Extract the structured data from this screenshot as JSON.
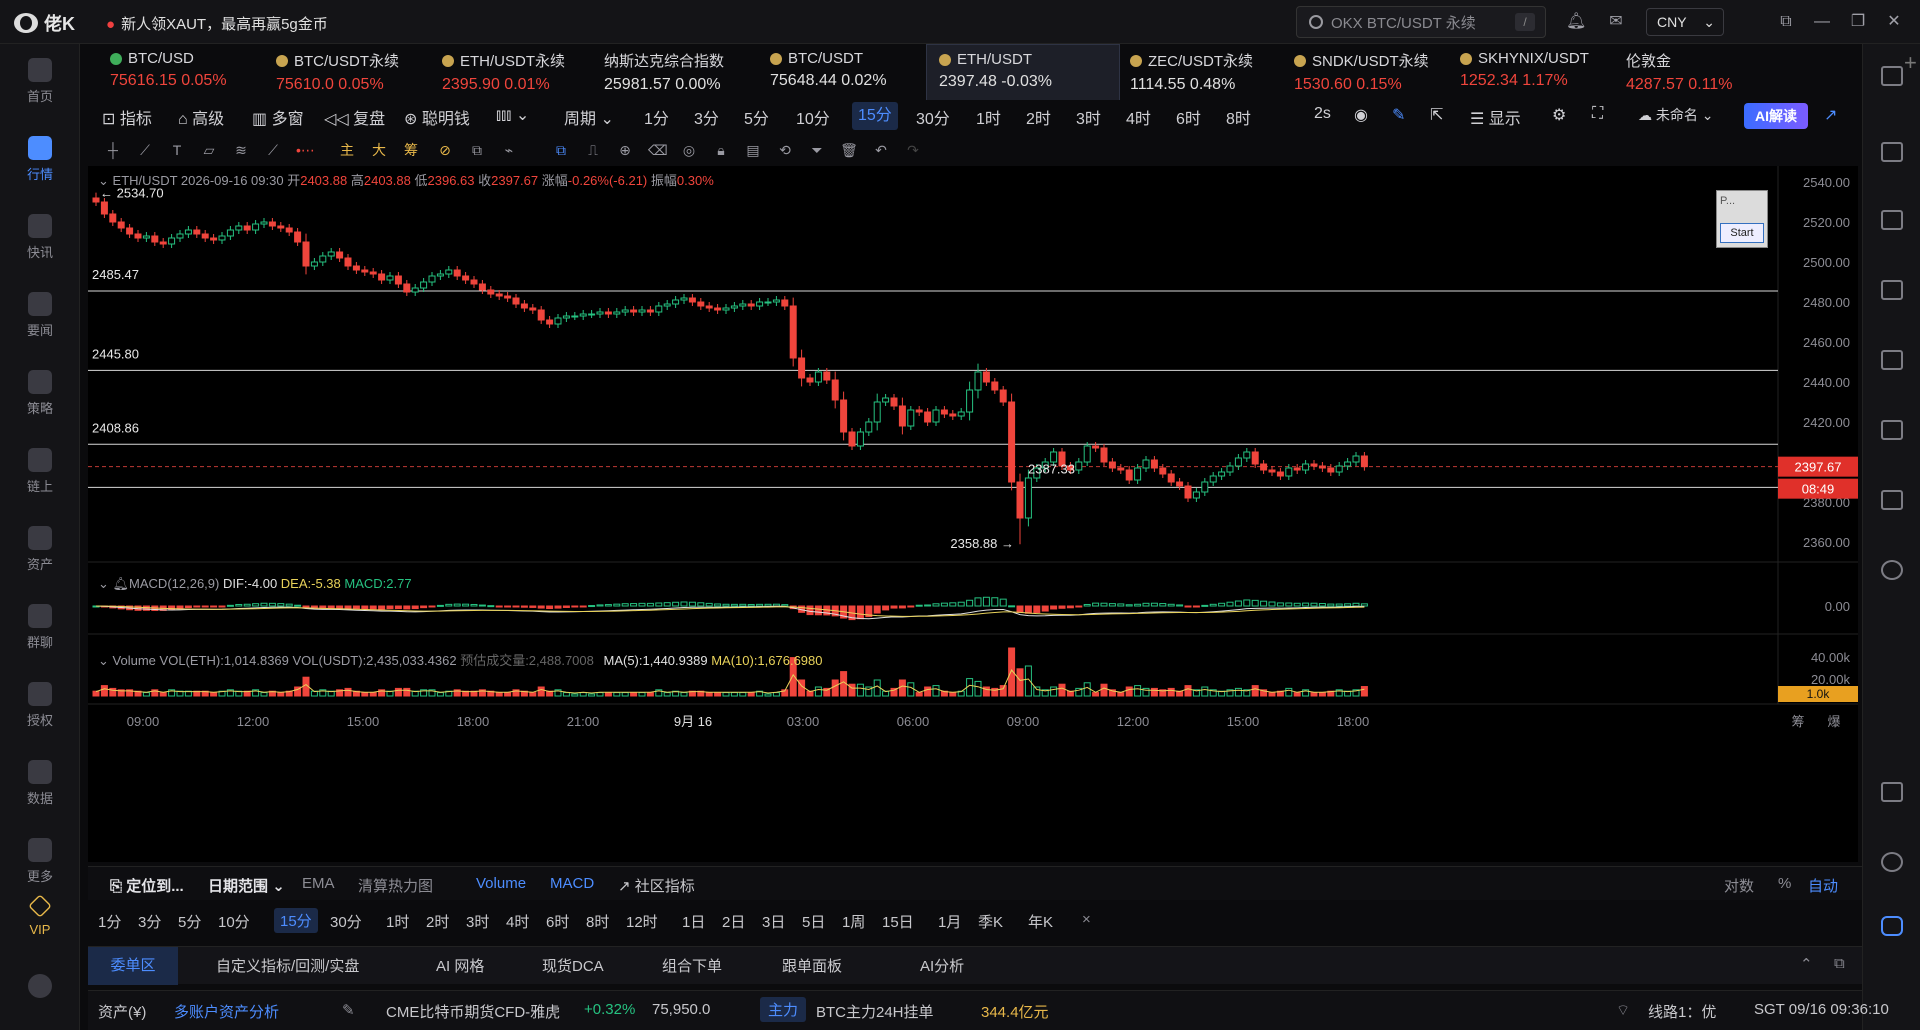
{
  "titlebar": {
    "app_name": "佬K",
    "promo": "新人领XAUT，最高再赢5g金币",
    "search_placeholder": "OKX BTC/USDT 永续",
    "search_shortcut": "/",
    "currency": "CNY"
  },
  "sidebar": {
    "items": [
      {
        "label": "首页",
        "icon": "home-icon"
      },
      {
        "label": "行情",
        "icon": "market-icon"
      },
      {
        "label": "快讯",
        "icon": "flash-news-icon"
      },
      {
        "label": "要闻",
        "icon": "headline-icon"
      },
      {
        "label": "策略",
        "icon": "strategy-icon"
      },
      {
        "label": "链上",
        "icon": "onchain-icon"
      },
      {
        "label": "资产",
        "icon": "wallet-icon"
      },
      {
        "label": "群聊",
        "icon": "chat-icon"
      },
      {
        "label": "授权",
        "icon": "auth-icon"
      },
      {
        "label": "数据",
        "icon": "data-icon"
      },
      {
        "label": "更多",
        "icon": "more-icon"
      },
      {
        "label": "VIP",
        "icon": "vip-icon"
      }
    ]
  },
  "tickers": [
    {
      "name": "BTC/USD",
      "price": "75616.15",
      "change": "0.05%",
      "tone": "red"
    },
    {
      "name": "BTC/USDT永续",
      "price": "75610.0",
      "change": "0.05%",
      "tone": "red"
    },
    {
      "name": "ETH/USDT永续",
      "price": "2395.90",
      "change": "0.01%",
      "tone": "red"
    },
    {
      "name": "纳斯达克综合指数",
      "price": "25981.57",
      "change": "0.00%",
      "tone": "neutral"
    },
    {
      "name": "BTC/USDT",
      "price": "75648.44",
      "change": "0.02%",
      "tone": "neutral"
    },
    {
      "name": "ETH/USDT",
      "price": "2397.48",
      "change": "-0.03%",
      "tone": "neutral"
    },
    {
      "name": "ZEC/USDT永续",
      "price": "1114.55",
      "change": "0.48%",
      "tone": "neutral"
    },
    {
      "name": "SNDK/USDT永续",
      "price": "1530.60",
      "change": "0.15%",
      "tone": "red"
    },
    {
      "name": "SKHYNIX/USDT",
      "price": "1252.34",
      "change": "1.17%",
      "tone": "red"
    },
    {
      "name": "伦敦金",
      "price": "4287.57",
      "change": "0.11%",
      "tone": "red"
    }
  ],
  "toolbar1": {
    "indicators": "指标",
    "advanced": "高级",
    "multi_window": "多窗",
    "replay": "复盘",
    "smart_money": "聪明钱",
    "period": "周期",
    "periods": [
      "1分",
      "3分",
      "5分",
      "10分",
      "15分",
      "30分",
      "1时",
      "2时",
      "3时",
      "4时",
      "6时",
      "8时"
    ],
    "refresh": "2s",
    "display": "显示",
    "layout_name": "未命名",
    "ai_button": "AI解读"
  },
  "chart": {
    "legend_main": {
      "symbol": "ETH/USDT",
      "datetime": "2026-09-16 09:30",
      "open_label": "开",
      "open": "2403.88",
      "high_label": "高",
      "high": "2403.88",
      "low_label": "低",
      "low": "2396.63",
      "close_label": "收",
      "close": "2397.67",
      "change_label": "涨幅",
      "change": "-0.26%(-6.21)",
      "amp_label": "振幅",
      "amp": "0.30%"
    },
    "legend_macd": {
      "label": "MACD(12,26,9)",
      "dif": "DIF:-4.00",
      "dea": "DEA:-5.38",
      "macd": "MACD:2.77"
    },
    "legend_vol": {
      "label": "Volume",
      "vol_eth": "VOL(ETH):1,014.8369",
      "vol_usdt": "VOL(USDT):2,435,033.4362",
      "est": "预估成交量:2,488.7008",
      "ma5": "MA(5):1,440.9389",
      "ma10": "MA(10):1,676.6980"
    },
    "annotations": {
      "high": "2534.70",
      "low": "2358.88",
      "level1": "2485.47",
      "level2": "2445.80",
      "level3": "2408.86",
      "level4": "2387.33"
    },
    "price_badge": "2397.67",
    "countdown_badge": "08:49",
    "vol_badge": "1.0k",
    "y_ticks": [
      "2540.00",
      "2520.00",
      "2500.00",
      "2480.00",
      "2460.00",
      "2440.00",
      "2420.00",
      "2400.00",
      "2380.00",
      "2360.00"
    ],
    "macd_tick": "0.00",
    "vol_ticks": [
      "40.00k",
      "20.00k"
    ],
    "x_ticks": [
      "09:00",
      "12:00",
      "15:00",
      "18:00",
      "21:00",
      "9月 16",
      "03:00",
      "06:00",
      "09:00",
      "12:00",
      "15:00",
      "18:00"
    ],
    "axis_corner": [
      "筹",
      "爆"
    ],
    "widget_title": "P...",
    "widget_button": "Start"
  },
  "chart_data": {
    "type": "candlestick",
    "symbol": "ETH/USDT",
    "interval": "15m",
    "ylim": [
      2352,
      2548
    ],
    "y_ticks": [
      2540,
      2520,
      2500,
      2480,
      2460,
      2440,
      2420,
      2400,
      2380,
      2360
    ],
    "horizontal_lines": [
      2485.47,
      2445.8,
      2408.86,
      2387.33
    ],
    "last_price": 2397.67,
    "close_series": [
      2530,
      2524,
      2520,
      2517,
      2514,
      2512,
      2513,
      2510,
      2509,
      2512,
      2514,
      2516,
      2514,
      2512,
      2511,
      2513,
      2516,
      2518,
      2516,
      2519,
      2520,
      2518,
      2517,
      2515,
      2510,
      2498,
      2500,
      2503,
      2505,
      2502,
      2498,
      2496,
      2495,
      2494,
      2491,
      2493,
      2489,
      2485,
      2487,
      2490,
      2493,
      2494,
      2496,
      2493,
      2491,
      2489,
      2486,
      2484,
      2483,
      2482,
      2479,
      2477,
      2476,
      2471,
      2469,
      2472,
      2473,
      2473,
      2474,
      2474,
      2475,
      2474,
      2475,
      2476,
      2475,
      2476,
      2475,
      2478,
      2479,
      2481,
      2482,
      2480,
      2478,
      2477,
      2476,
      2477,
      2478,
      2479,
      2478,
      2480,
      2480,
      2481,
      2478,
      2452,
      2442,
      2440,
      2445,
      2441,
      2431,
      2415,
      2408,
      2415,
      2420,
      2430,
      2432,
      2428,
      2418,
      2426,
      2425,
      2420,
      2426,
      2424,
      2423,
      2425,
      2436,
      2445,
      2440,
      2436,
      2430,
      2390,
      2372,
      2392,
      2397,
      2400,
      2405,
      2398,
      2396,
      2400,
      2408,
      2407,
      2400,
      2397,
      2396,
      2391,
      2397,
      2401,
      2397,
      2394,
      2390,
      2388,
      2382,
      2385,
      2390,
      2393,
      2395,
      2398,
      2402,
      2405,
      2399,
      2396,
      2395,
      2393,
      2397,
      2396,
      2399,
      2398,
      2397,
      2395,
      2398,
      2400,
      2403,
      2397.67
    ]
  },
  "bottom1": {
    "locate": "定位到...",
    "date_range": "日期范围",
    "ema": "EMA",
    "heatmap": "清算热力图",
    "volume": "Volume",
    "macd": "MACD",
    "community": "社区指标",
    "log": "对数",
    "percent": "%",
    "auto": "自动"
  },
  "bottom2": {
    "periods": [
      "1分",
      "3分",
      "5分",
      "10分",
      "15分",
      "30分",
      "1时",
      "2时",
      "3时",
      "4时",
      "6时",
      "8时",
      "12时",
      "1日",
      "2日",
      "3日",
      "5日",
      "1周",
      "15日",
      "1月",
      "季K",
      "年K"
    ],
    "close": "×"
  },
  "bottom3": {
    "tabs": [
      "委单区",
      "自定义指标/回测/实盘",
      "AI 网格",
      "现货DCA",
      "组合下单",
      "跟单面板",
      "AI分析"
    ]
  },
  "statusbar": {
    "assets": "资产(¥)",
    "multi_account": "多账户资产分析",
    "cfd_name": "CME比特币期货CFD-雅虎",
    "cfd_change": "+0.32%",
    "cfd_price": "75,950.0",
    "main_tag": "主力",
    "btc_orders_label": "BTC主力24H挂单",
    "btc_orders_value": "344.4亿元",
    "line": "线路1：优",
    "clock": "SGT 09/16 09:36:10"
  }
}
